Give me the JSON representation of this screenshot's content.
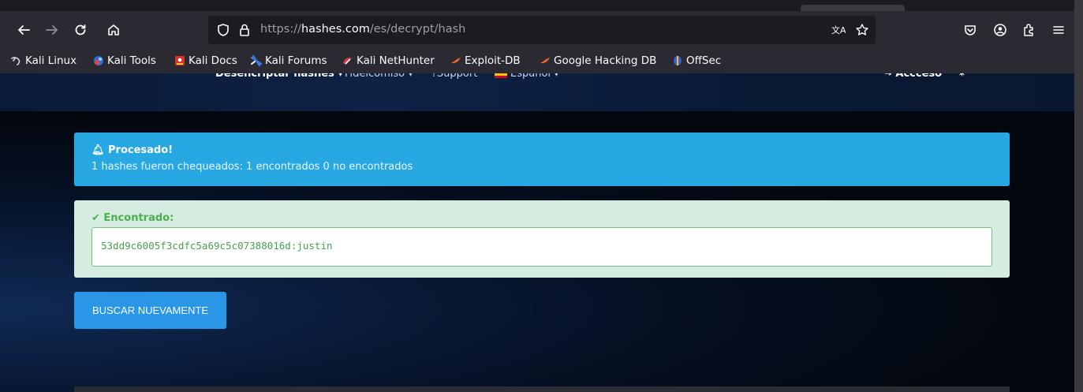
{
  "browser": {
    "url": {
      "scheme": "https://",
      "host": "hashes.com",
      "path": "/es/decrypt/hash"
    },
    "bookmarks": [
      {
        "label": "Kali Linux",
        "icon": "kali-dragon-icon"
      },
      {
        "label": "Kali Tools",
        "icon": "kali-tools-icon"
      },
      {
        "label": "Kali Docs",
        "icon": "kali-docs-icon"
      },
      {
        "label": "Kali Forums",
        "icon": "kali-forums-icon"
      },
      {
        "label": "Kali NetHunter",
        "icon": "nethunter-icon"
      },
      {
        "label": "Exploit-DB",
        "icon": "exploit-db-icon"
      },
      {
        "label": "Google Hacking DB",
        "icon": "ghdb-icon"
      },
      {
        "label": "OffSec",
        "icon": "offsec-icon"
      }
    ]
  },
  "site_nav": {
    "decrypt": "Desencriptar hashes ▾",
    "escrow": "Fideicomiso ▾",
    "support": "?Support",
    "language": "Español ▾",
    "login": "↪ Accceso"
  },
  "alert_info": {
    "title": "Procesado!",
    "message": "1 hashes fueron chequeados: 1 encontrados 0 no encontrados"
  },
  "alert_success": {
    "title": "Encontrado:",
    "result": "53dd9c6005f3cdfc5a69c5c07388016d:justin"
  },
  "buttons": {
    "search_again": "BUSCAR NUEVAMENTE"
  },
  "colors": {
    "info": "#28a8e2",
    "success_bg": "#d4ede0",
    "success_text": "#4cae4c",
    "button": "#2996e6"
  }
}
